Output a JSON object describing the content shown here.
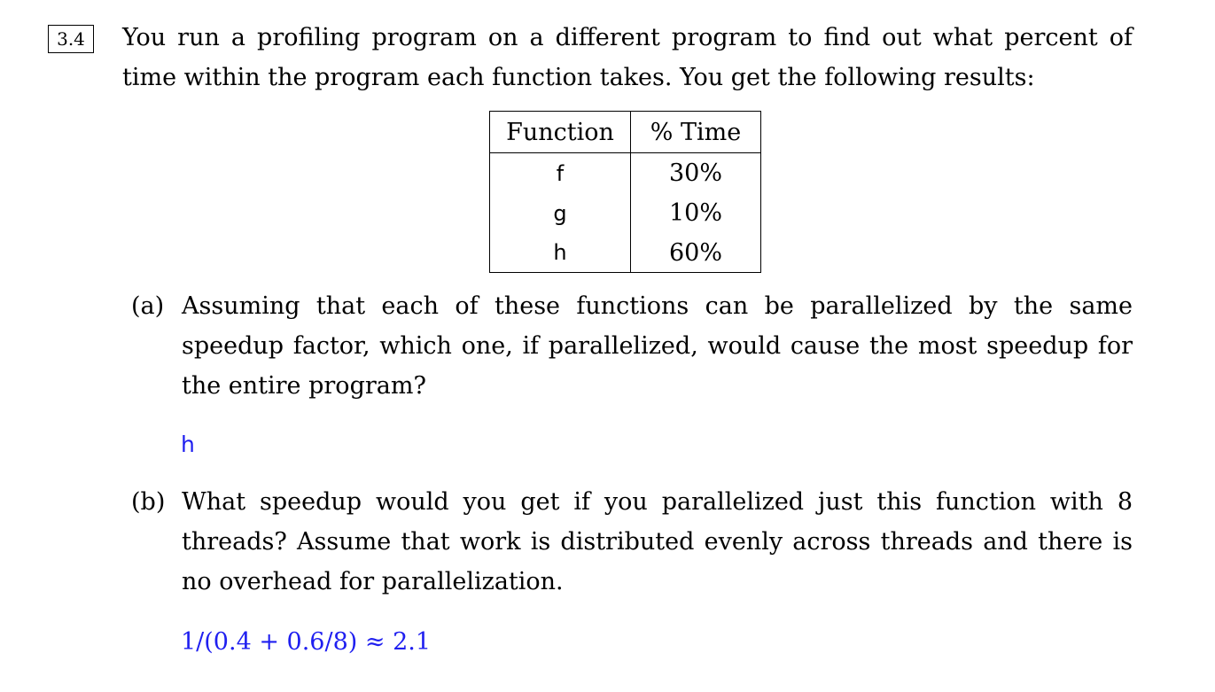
{
  "problem": {
    "number": "3.4",
    "intro": "You run a profiling program on a different program to find out what percent of time within the program each function takes. You get the following results:"
  },
  "table": {
    "headers": [
      "Function",
      "% Time"
    ],
    "rows": [
      {
        "function": "f",
        "time": "30%"
      },
      {
        "function": "g",
        "time": "10%"
      },
      {
        "function": "h",
        "time": "60%"
      }
    ]
  },
  "parts": [
    {
      "label": "(a)",
      "question": "Assuming that each of these functions can be parallelized by the same speedup factor, which one, if parallelized, would cause the most speedup for the entire program?",
      "answer": "h"
    },
    {
      "label": "(b)",
      "question": "What speedup would you get if you parallelized just this function with 8 threads? Assume that work is distributed evenly across threads and there is no overhead for parallelization.",
      "answer": "1/(0.4 + 0.6/8) ≈ 2.1"
    }
  ],
  "colors": {
    "answer": "#1f1ff0",
    "text": "#000000"
  }
}
